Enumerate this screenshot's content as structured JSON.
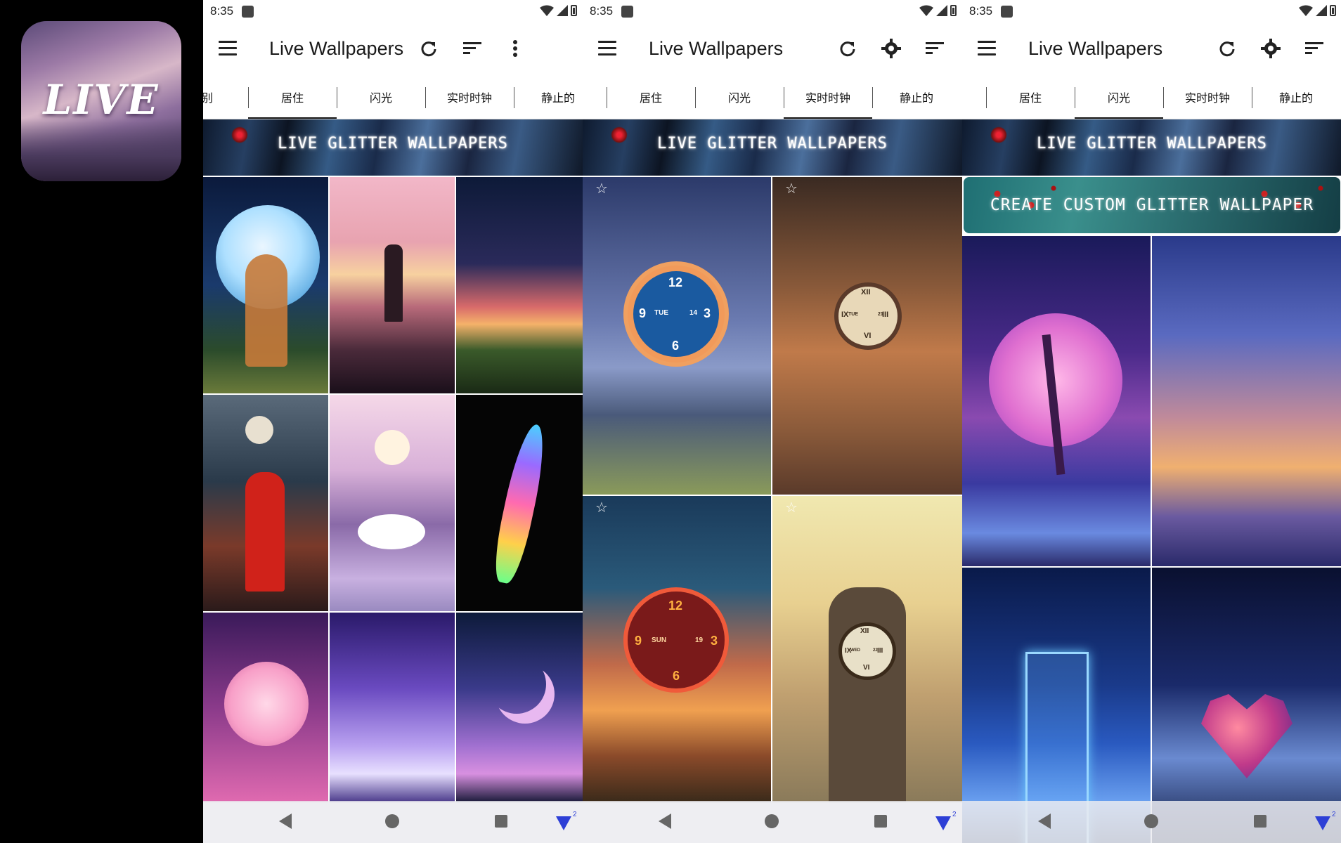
{
  "status": {
    "time": "8:35"
  },
  "app": {
    "title": "Live Wallpapers",
    "icon_text": "LIVE"
  },
  "phone1": {
    "tabs": [
      "类别",
      "居住",
      "闪光",
      "实时时钟",
      "静止的"
    ],
    "active_tab": 1
  },
  "phone2": {
    "tabs": [
      "居住",
      "闪光",
      "实时时钟",
      "静止的"
    ],
    "active_tab": 2
  },
  "phone3": {
    "tabs": [
      "居住",
      "闪光",
      "实时时钟",
      "静止的"
    ],
    "active_tab": 1
  },
  "banner": {
    "text": "LIVE GLITTER WALLPAPERS"
  },
  "create_banner": {
    "text": "CREATE CUSTOM GLITTER WALLPAPER"
  },
  "clock1": {
    "n12": "12",
    "n3": "3",
    "n6": "6",
    "n9": "9",
    "day": "TUE",
    "date": "14"
  },
  "clock2": {
    "n12": "XII",
    "n3": "III",
    "n6": "VI",
    "n9": "IX",
    "day": "TUE",
    "date": "21"
  },
  "clock3": {
    "n12": "12",
    "n3": "3",
    "n6": "6",
    "n9": "9",
    "day": "SUN",
    "date": "19"
  },
  "clock4": {
    "n12": "XII",
    "n3": "III",
    "n6": "VI",
    "n9": "IX",
    "day": "WED",
    "date": "22"
  },
  "nav": {
    "badge": "2"
  },
  "icons": {
    "menu": "hamburger-icon",
    "refresh": "refresh-icon",
    "sort": "sort-icon",
    "more": "more-vert-icon",
    "settings": "gear-icon"
  }
}
